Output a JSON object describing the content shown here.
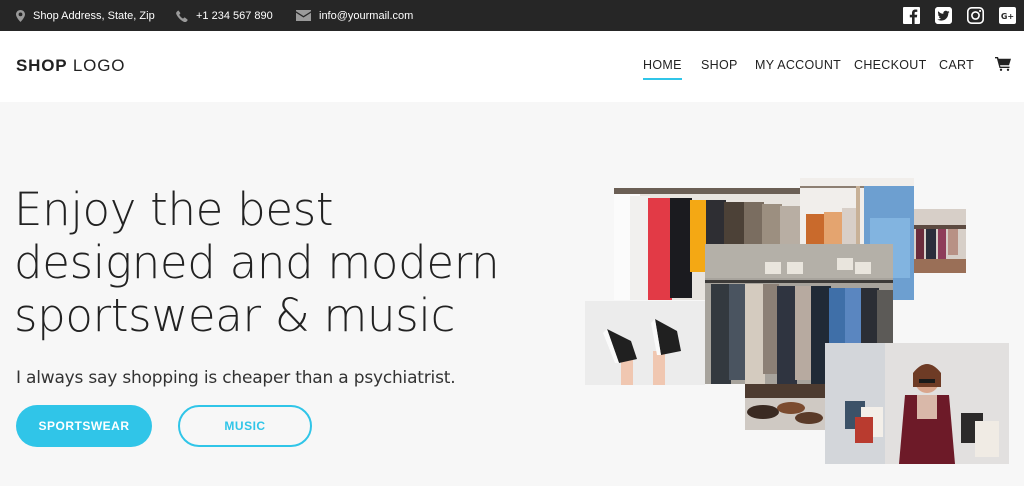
{
  "topbar": {
    "address": "Shop Address, State, Zip",
    "phone": "+1 234 567 890",
    "email": "info@yourmail.com",
    "socials": [
      "facebook-icon",
      "twitter-icon",
      "instagram-icon",
      "google-plus-icon"
    ]
  },
  "header": {
    "logo_bold": "SHOP",
    "logo_light": "LOGO",
    "nav": {
      "home": "HOME",
      "shop": "SHOP",
      "account": "MY ACCOUNT",
      "checkout": "CHECKOUT",
      "cart": "CART"
    },
    "active_nav": "HOME"
  },
  "hero": {
    "title_line1": "Enjoy the best",
    "title_line2": "designed and modern",
    "title_line3": "sportswear & music",
    "subtitle": "I always say shopping is cheaper than a psychiatrist.",
    "primary_button": "SPORTSWEAR",
    "secondary_button": "MUSIC"
  },
  "colors": {
    "accent": "#30c5e8",
    "topbar": "#262626",
    "background": "#f7f7f7"
  }
}
